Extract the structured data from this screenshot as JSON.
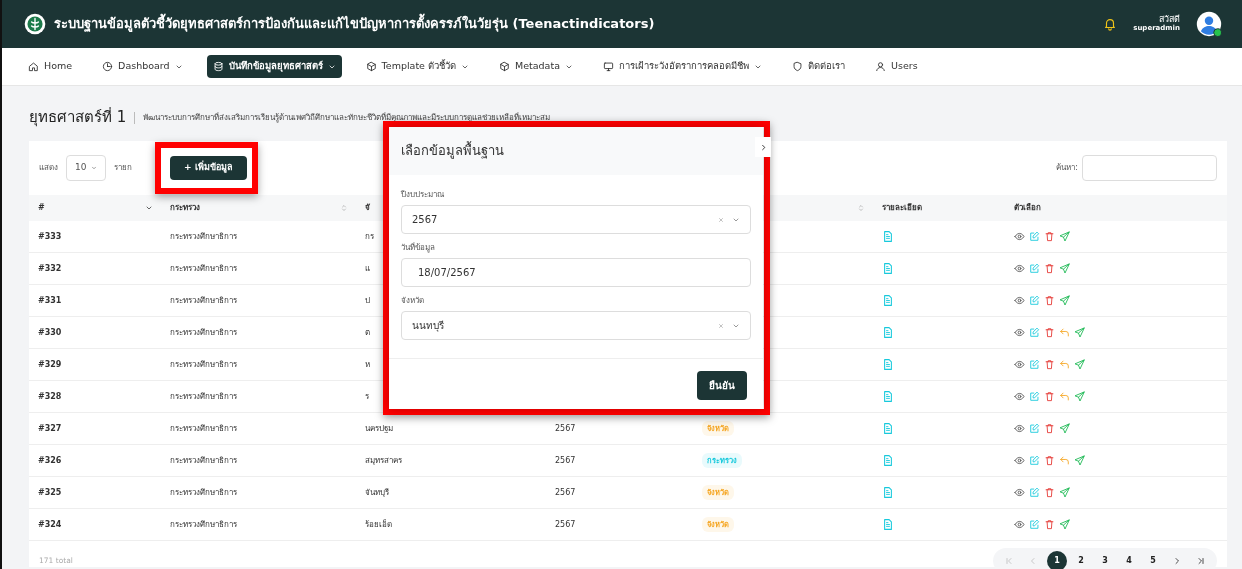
{
  "header": {
    "title": "ระบบฐานข้อมูลตัวชี้วัดยุทธศาสตร์การป้องกันและแก้ไขปัญหาการตั้งครรภ์ในวัยรุ่น (Teenactindicators)",
    "greeting": "สวัสดี",
    "username": "superadmin",
    "online": true
  },
  "nav": [
    {
      "label": "Home",
      "dropdown": false,
      "selected": false
    },
    {
      "label": "Dashboard",
      "dropdown": true,
      "selected": false
    },
    {
      "label": "บันทึกข้อมูลยุทธศาสตร์",
      "dropdown": true,
      "selected": true
    },
    {
      "label": "Template ตัวชี้วัด",
      "dropdown": true,
      "selected": false
    },
    {
      "label": "Metadata",
      "dropdown": true,
      "selected": false
    },
    {
      "label": "การเฝ้าระวังอัตราการคลอดมีชีพ",
      "dropdown": true,
      "selected": false
    },
    {
      "label": "ติดต่อเรา",
      "dropdown": false,
      "selected": false
    },
    {
      "label": "Users",
      "dropdown": false,
      "selected": false
    }
  ],
  "page": {
    "title": "ยุทธศาสตร์ที่ 1",
    "description": "พัฒนาระบบการศึกษาที่ส่งเสริมการเรียนรู้ด้านเพศวิถีศึกษาและทักษะชีวิตที่มีคุณภาพและมีระบบการดูแลช่วยเหลือที่เหมาะสม"
  },
  "toolbar": {
    "show_label": "แสดง",
    "page_size": "10",
    "page_size_suffix": "รายก",
    "add_button": "+ เพิ่มข้อมูล",
    "search_label": "ค้นหา:"
  },
  "table": {
    "columns": [
      {
        "label": "#"
      },
      {
        "label": "กระทรวง"
      },
      {
        "label": "จั"
      },
      {},
      {},
      {
        "label": "รายละเอียด"
      },
      {
        "label": "ตัวเลือก"
      }
    ],
    "rows": [
      {
        "id": "#333",
        "ministry": "กระทรวงศึกษาธิการ",
        "province": "กร",
        "returnable": false
      },
      {
        "id": "#332",
        "ministry": "กระทรวงศึกษาธิการ",
        "province": "แ",
        "returnable": false
      },
      {
        "id": "#331",
        "ministry": "กระทรวงศึกษาธิการ",
        "province": "ป",
        "returnable": false
      },
      {
        "id": "#330",
        "ministry": "กระทรวงศึกษาธิการ",
        "province": "ต",
        "returnable": true
      },
      {
        "id": "#329",
        "ministry": "กระทรวงศึกษาธิการ",
        "province": "ห",
        "returnable": true
      },
      {
        "id": "#328",
        "ministry": "กระทรวงศึกษาธิการ",
        "province": "ร",
        "returnable": true
      },
      {
        "id": "#327",
        "ministry": "กระทรวงศึกษาธิการ",
        "province": "นครปฐม",
        "year": "2567",
        "badge": {
          "text": "จังหวัด",
          "color": "#f5a623"
        },
        "returnable": false
      },
      {
        "id": "#326",
        "ministry": "กระทรวงศึกษาธิการ",
        "province": "สมุทรสาคร",
        "year": "2567",
        "badge": {
          "text": "กระทรวง",
          "color": "#17c9dc"
        },
        "returnable": true
      },
      {
        "id": "#325",
        "ministry": "กระทรวงศึกษาธิการ",
        "province": "จันทบุรี",
        "year": "2567",
        "badge": {
          "text": "จังหวัด",
          "color": "#f5a623"
        },
        "returnable": false
      },
      {
        "id": "#324",
        "ministry": "กระทรวงศึกษาธิการ",
        "province": "ร้อยเอ็ด",
        "year": "2567",
        "badge": {
          "text": "จังหวัด",
          "color": "#f5a623"
        },
        "returnable": false
      }
    ]
  },
  "footer": {
    "total": "171 total",
    "pages": [
      {
        "label": "1",
        "selected": true
      },
      {
        "label": "2",
        "selected": false
      },
      {
        "label": "3",
        "selected": false
      },
      {
        "label": "4",
        "selected": false
      },
      {
        "label": "5",
        "selected": false
      }
    ]
  },
  "modal": {
    "title": "เลือกข้อมูลพื้นฐาน",
    "fields": [
      {
        "kind": "select",
        "label": "ปีงบประมาณ",
        "value": "2567"
      },
      {
        "kind": "date",
        "label": "วันที่ข้อมูล",
        "value": "18/07/2567"
      },
      {
        "kind": "select",
        "label": "จังหวัด",
        "value": "นนทบุรี"
      }
    ],
    "confirm": "ยืนยัน"
  }
}
